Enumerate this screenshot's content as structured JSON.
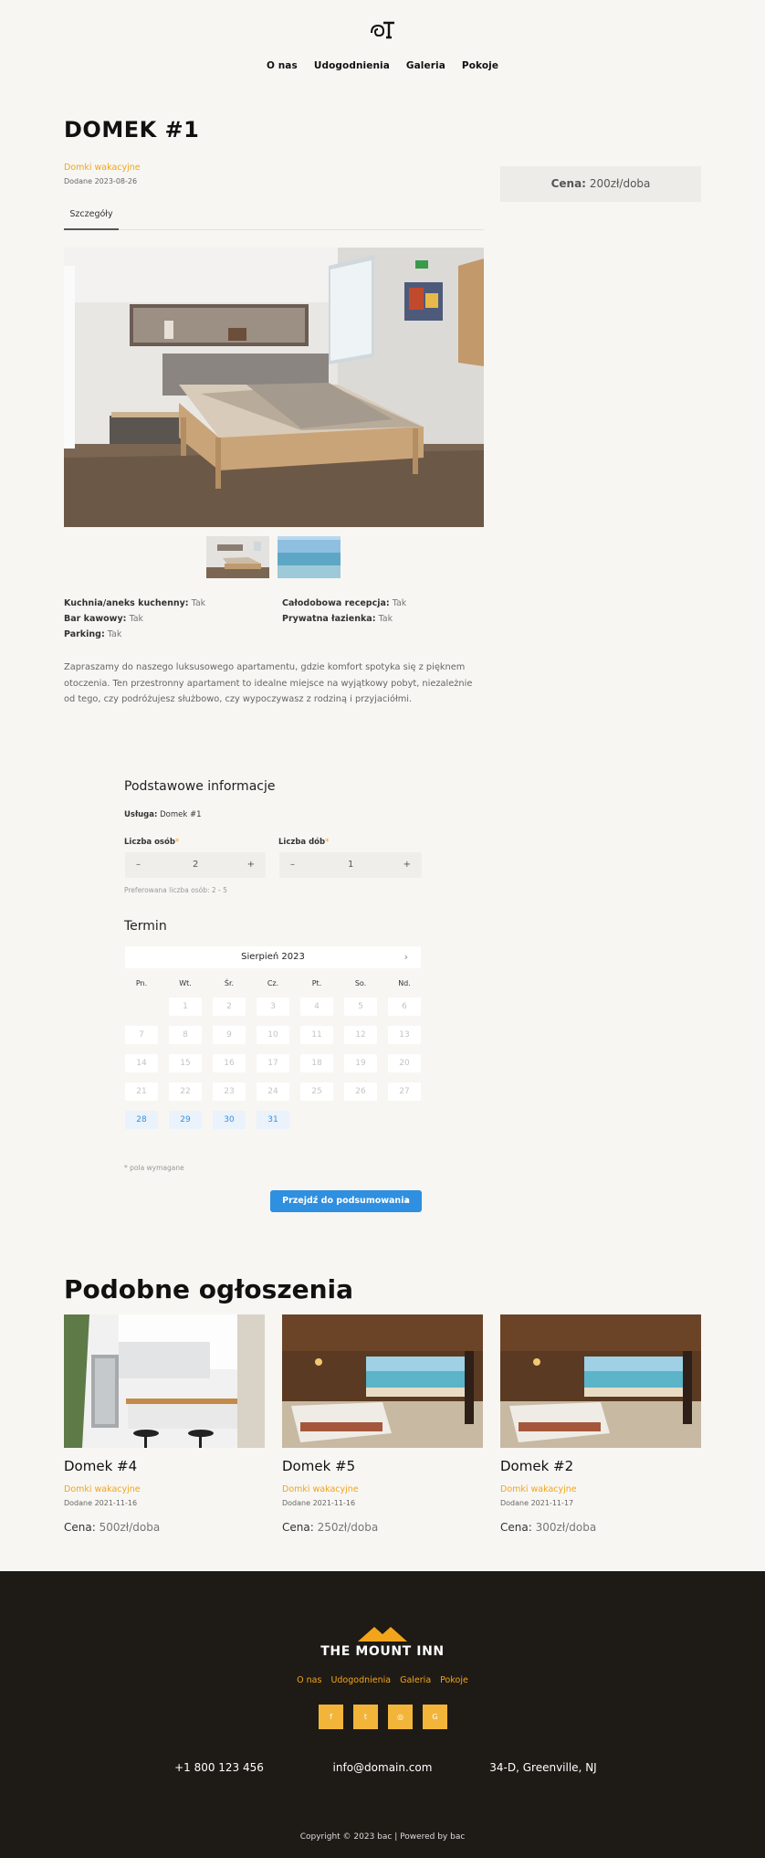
{
  "nav": [
    "O nas",
    "Udogodnienia",
    "Galeria",
    "Pokoje"
  ],
  "listing": {
    "title": "DOMEK #1",
    "category": "Domki wakacyjne",
    "added": "Dodane 2023-08-26",
    "tab": "Szczegóły",
    "price_label": "Cena:",
    "price_value": "200zł/doba",
    "amenities": [
      {
        "label": "Kuchnia/aneks kuchenny:",
        "value": "Tak"
      },
      {
        "label": "Bar kawowy:",
        "value": "Tak"
      },
      {
        "label": "Parking:",
        "value": "Tak"
      },
      {
        "label": "Całodobowa recepcja:",
        "value": "Tak"
      },
      {
        "label": "Prywatna łazienka:",
        "value": "Tak"
      }
    ],
    "description": "Zapraszamy do naszego luksusowego apartamentu, gdzie komfort spotyka się z pięknem otoczenia. Ten przestronny apartament to idealne miejsce na wyjątkowy pobyt, niezależnie od tego, czy podróżujesz służbowo, czy wypoczywasz z rodziną i przyjaciółmi."
  },
  "booking": {
    "section_title": "Podstawowe informacje",
    "service_label": "Usługa:",
    "service_value": "Domek #1",
    "guests_label": "Liczba osób",
    "guests_value": "2",
    "nights_label": "Liczba dób",
    "nights_value": "1",
    "minus": "–",
    "plus": "+",
    "required_mark": "*",
    "guests_hint": "Preferowana liczba osób: 2 - 5",
    "term_title": "Termin",
    "month": "Sierpień 2023",
    "next": "›",
    "weekdays": [
      "Pn.",
      "Wt.",
      "Śr.",
      "Cz.",
      "Pt.",
      "So.",
      "Nd."
    ],
    "days": [
      "1",
      "2",
      "3",
      "4",
      "5",
      "6",
      "7",
      "8",
      "9",
      "10",
      "11",
      "12",
      "13",
      "14",
      "15",
      "16",
      "17",
      "18",
      "19",
      "20",
      "21",
      "22",
      "23",
      "24",
      "25",
      "26",
      "27",
      "28",
      "29",
      "30",
      "31"
    ],
    "first_weekday_index": 1,
    "available_from": 28,
    "required_note": "* pola wymagane",
    "cta": "Przejdź do podsumowania",
    "cta_chevron": "›"
  },
  "similar": {
    "title": "Podobne ogłoszenia",
    "items": [
      {
        "name": "Domek #4",
        "category": "Domki wakacyjne",
        "added": "Dodane 2021-11-16",
        "price_label": "Cena:",
        "price": "500zł/doba"
      },
      {
        "name": "Domek #5",
        "category": "Domki wakacyjne",
        "added": "Dodane 2021-11-16",
        "price_label": "Cena:",
        "price": "250zł/doba"
      },
      {
        "name": "Domek #2",
        "category": "Domki wakacyjne",
        "added": "Dodane 2021-11-17",
        "price_label": "Cena:",
        "price": "300zł/doba"
      }
    ]
  },
  "footer": {
    "brand": "THE MOUNT INN",
    "nav": [
      "O nas",
      "Udogodnienia",
      "Galeria",
      "Pokoje"
    ],
    "socials": [
      "f",
      "t",
      "◎",
      "G"
    ],
    "phone": "+1 800 123 456",
    "email": "info@domain.com",
    "address": "34-D, Greenville, NJ",
    "copyright": "Copyright © 2023 bac | Powered by bac"
  },
  "colors": {
    "accent": "#f2a51a",
    "primary": "#2f8fe0",
    "footer_bg": "#1e1a16",
    "page_bg": "#f7f6f3"
  }
}
